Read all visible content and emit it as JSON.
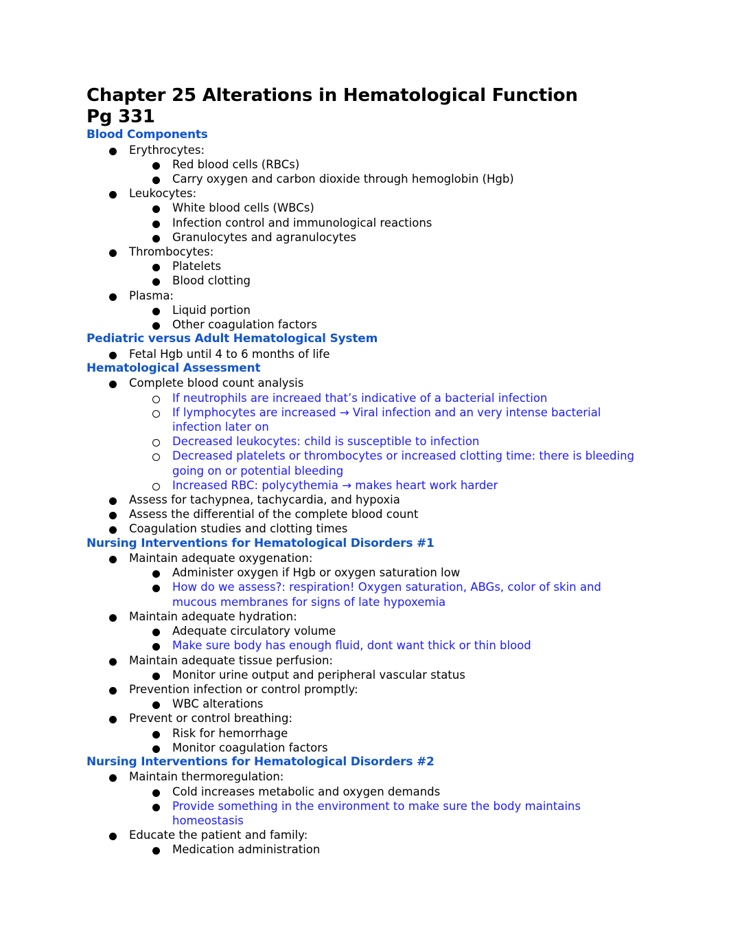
{
  "title_line1": "Chapter 25 Alterations in Hematological Function",
  "title_line2": "Pg 331",
  "colors": {
    "heading": "#1155cc",
    "annotation": "#1a1aff",
    "text": "#000000"
  },
  "sections": [
    {
      "heading": "Blood Components",
      "items": [
        {
          "text": "Erythrocytes:",
          "children": [
            {
              "text": "Red blood cells (RBCs)"
            },
            {
              "text": "Carry oxygen and carbon dioxide through hemoglobin (Hgb)"
            }
          ]
        },
        {
          "text": "Leukocytes:",
          "children": [
            {
              "text": "White blood cells (WBCs)"
            },
            {
              "text": "Infection control and immunological reactions"
            },
            {
              "text": "Granulocytes and agranulocytes"
            }
          ]
        },
        {
          "text": "Thrombocytes:",
          "children": [
            {
              "text": "Platelets"
            },
            {
              "text": "Blood clotting"
            }
          ]
        },
        {
          "text": "Plasma:",
          "children": [
            {
              "text": "Liquid portion"
            },
            {
              "text": "Other coagulation factors"
            }
          ]
        }
      ]
    },
    {
      "heading": "Pediatric versus Adult Hematological System",
      "items": [
        {
          "text": "Fetal Hgb until 4 to 6 months of life"
        }
      ]
    },
    {
      "heading": "Hematological Assessment",
      "items": [
        {
          "text": "Complete blood count analysis",
          "children": [
            {
              "text": "If neutrophils are increaed that’s indicative of a bacterial infection",
              "note": true,
              "hollow": true
            },
            {
              "text": "If lymphocytes are increased → Viral infection and an very intense bacterial infection later on",
              "note": true,
              "hollow": true
            },
            {
              "text": "Decreased leukocytes: child is susceptible to infection",
              "note": true,
              "hollow": true
            },
            {
              "text": "Decreased platelets or thrombocytes or increased clotting time: there is bleeding going on or potential bleeding",
              "note": true,
              "hollow": true
            },
            {
              "text": "Increased RBC: polycythemia → makes heart work harder",
              "note": true,
              "hollow": true
            }
          ]
        },
        {
          "text": "Assess for tachypnea, tachycardia, and hypoxia"
        },
        {
          "text": "Assess the differential of the complete blood count"
        },
        {
          "text": "Coagulation studies and clotting times"
        }
      ]
    },
    {
      "heading": "Nursing Interventions for Hematological Disorders #1",
      "items": [
        {
          "text": "Maintain adequate oxygenation:",
          "children": [
            {
              "text": "Administer oxygen if Hgb or oxygen saturation low"
            },
            {
              "text": "How do we assess?: respiration! Oxygen saturation, ABGs, color of skin and mucous membranes for signs of late hypoxemia",
              "note": true
            }
          ]
        },
        {
          "text": "Maintain adequate hydration:",
          "children": [
            {
              "text": "Adequate circulatory volume"
            },
            {
              "text": "Make sure body has enough fluid, dont want thick or thin blood",
              "note": true
            }
          ]
        },
        {
          "text": "Maintain adequate tissue perfusion:",
          "children": [
            {
              "text": "Monitor urine output and peripheral vascular status"
            }
          ]
        },
        {
          "text": "Prevention infection or control promptly:",
          "children": [
            {
              "text": "WBC alterations"
            }
          ]
        },
        {
          "text": "Prevent or control breathing:",
          "children": [
            {
              "text": "Risk for hemorrhage"
            },
            {
              "text": "Monitor coagulation factors"
            }
          ]
        }
      ]
    },
    {
      "heading": "Nursing Interventions for Hematological Disorders #2",
      "items": [
        {
          "text": "Maintain thermoregulation:",
          "children": [
            {
              "text": "Cold increases metabolic and oxygen demands"
            },
            {
              "text": "Provide something in the environment to make sure the body maintains homeostasis",
              "note": true
            }
          ]
        },
        {
          "text": "Educate the patient and family:",
          "children": [
            {
              "text": "Medication administration"
            }
          ]
        }
      ]
    }
  ]
}
